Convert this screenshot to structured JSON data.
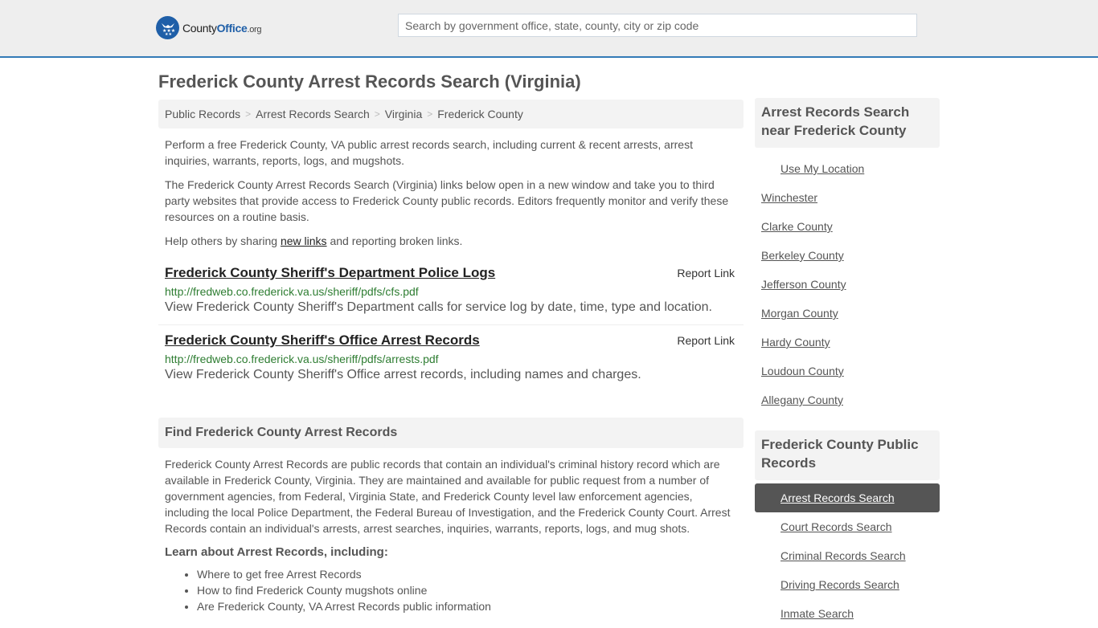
{
  "header": {
    "logo": {
      "icon": "eagle-stars-badge-icon",
      "text_prefix": "County",
      "text_bold": "Office",
      "text_suffix": ".org"
    },
    "search": {
      "placeholder": "Search by government office, state, county, city or zip code",
      "value": ""
    },
    "accent_color": "#337ab7"
  },
  "page_title": "Frederick County Arrest Records Search (Virginia)",
  "breadcrumb": {
    "items": [
      "Public Records",
      "Arrest Records Search",
      "Virginia",
      "Frederick County"
    ],
    "separator": ">"
  },
  "intro": {
    "p1": "Perform a free Frederick County, VA public arrest records search, including current & recent arrests, arrest inquiries, warrants, reports, logs, and mugshots.",
    "p2": "The Frederick County Arrest Records Search (Virginia) links below open in a new window and take you to third party websites that provide access to Frederick County public records. Editors frequently monitor and verify these resources on a routine basis.",
    "p3_before": "Help others by sharing ",
    "p3_link": "new links",
    "p3_after": " and reporting broken links."
  },
  "links": [
    {
      "title": "Frederick County Sheriff's Department Police Logs",
      "report_label": "Report Link",
      "url": "http://fredweb.co.frederick.va.us/sheriff/pdfs/cfs.pdf",
      "description": "View Frederick County Sheriff's Department calls for service log by date, time, type and location."
    },
    {
      "title": "Frederick County Sheriff's Office Arrest Records",
      "report_label": "Report Link",
      "url": "http://fredweb.co.frederick.va.us/sheriff/pdfs/arrests.pdf",
      "description": "View Frederick County Sheriff's Office arrest records, including names and charges."
    }
  ],
  "find_section": {
    "heading": "Find Frederick County Arrest Records",
    "body": "Frederick County Arrest Records are public records that contain an individual's criminal history record which are available in Frederick County, Virginia. They are maintained and available for public request from a number of government agencies, from Federal, Virginia State, and Frederick County level law enforcement agencies, including the local Police Department, the Federal Bureau of Investigation, and the Frederick County Court. Arrest Records contain an individual's arrests, arrest searches, inquiries, warrants, reports, logs, and mug shots.",
    "learn_heading": "Learn about Arrest Records, including:",
    "bullets": [
      "Where to get free Arrest Records",
      "How to find Frederick County mugshots online",
      "Are Frederick County, VA Arrest Records public information"
    ]
  },
  "sidebar": {
    "near": {
      "heading": "Arrest Records Search near Frederick County",
      "use_location": "Use My Location",
      "items": [
        "Winchester",
        "Clarke County",
        "Berkeley County",
        "Jefferson County",
        "Morgan County",
        "Hardy County",
        "Loudoun County",
        "Allegany County"
      ]
    },
    "public_records": {
      "heading": "Frederick County Public Records",
      "active_index": 0,
      "items": [
        "Arrest Records Search",
        "Court Records Search",
        "Criminal Records Search",
        "Driving Records Search",
        "Inmate Search"
      ]
    }
  }
}
